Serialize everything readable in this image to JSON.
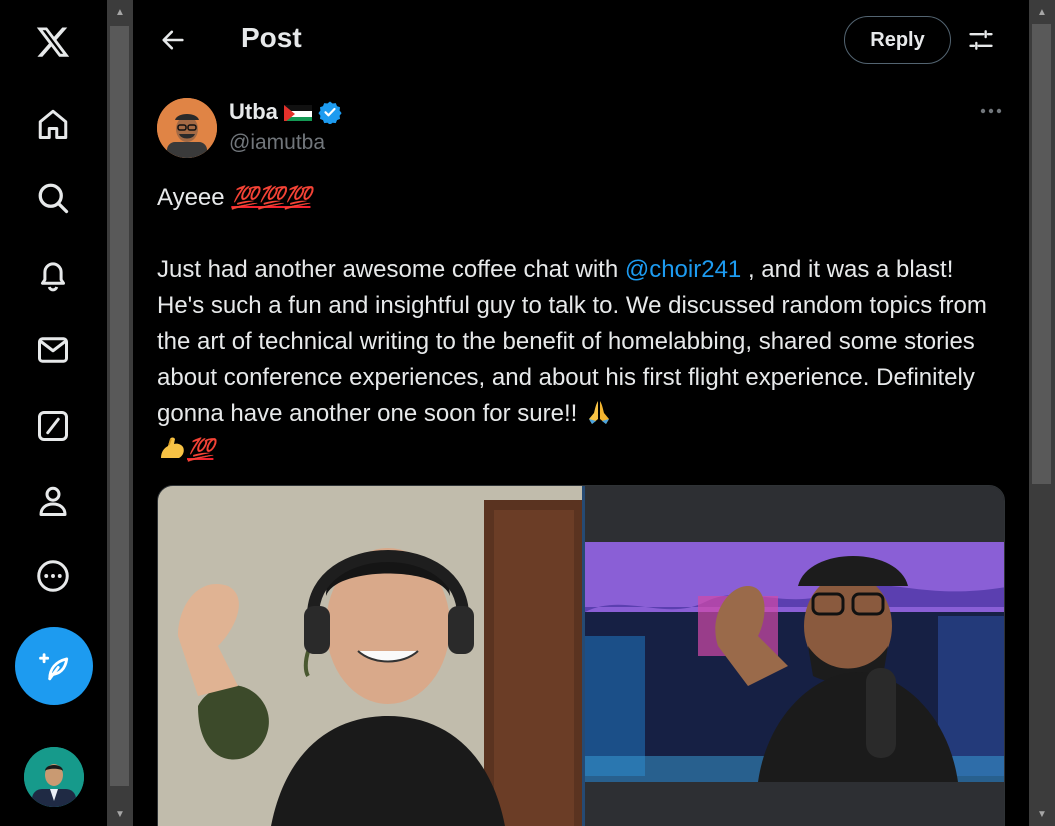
{
  "header": {
    "title": "Post",
    "reply_label": "Reply"
  },
  "author": {
    "name": "Utba",
    "handle": "@iamutba",
    "verified": true,
    "flag": "palestine-flag"
  },
  "post": {
    "line1_text": "Ayeee ",
    "line1_emoji": "💯💯💯",
    "body_before_mention": "Just had another awesome coffee chat with ",
    "mention": "@choir241",
    "body_after_mention": " , and it was a blast! He's such a fun and insightful guy to talk to. We discussed random topics from the art of technical writing to the benefit of homelabbing, shared some stories about conference experiences, and about his first flight experience. Definitely gonna have another one soon for sure!! ",
    "ending_emoji": "💯"
  },
  "nav": [
    "x-logo-icon",
    "home-icon",
    "search-icon",
    "notifications-icon",
    "messages-icon",
    "grok-icon",
    "profile-icon",
    "more-icon",
    "compose-icon"
  ],
  "colors": {
    "accent": "#1d9bf0",
    "background": "#000000",
    "text": "#e7e9ea",
    "muted": "#71767b"
  }
}
